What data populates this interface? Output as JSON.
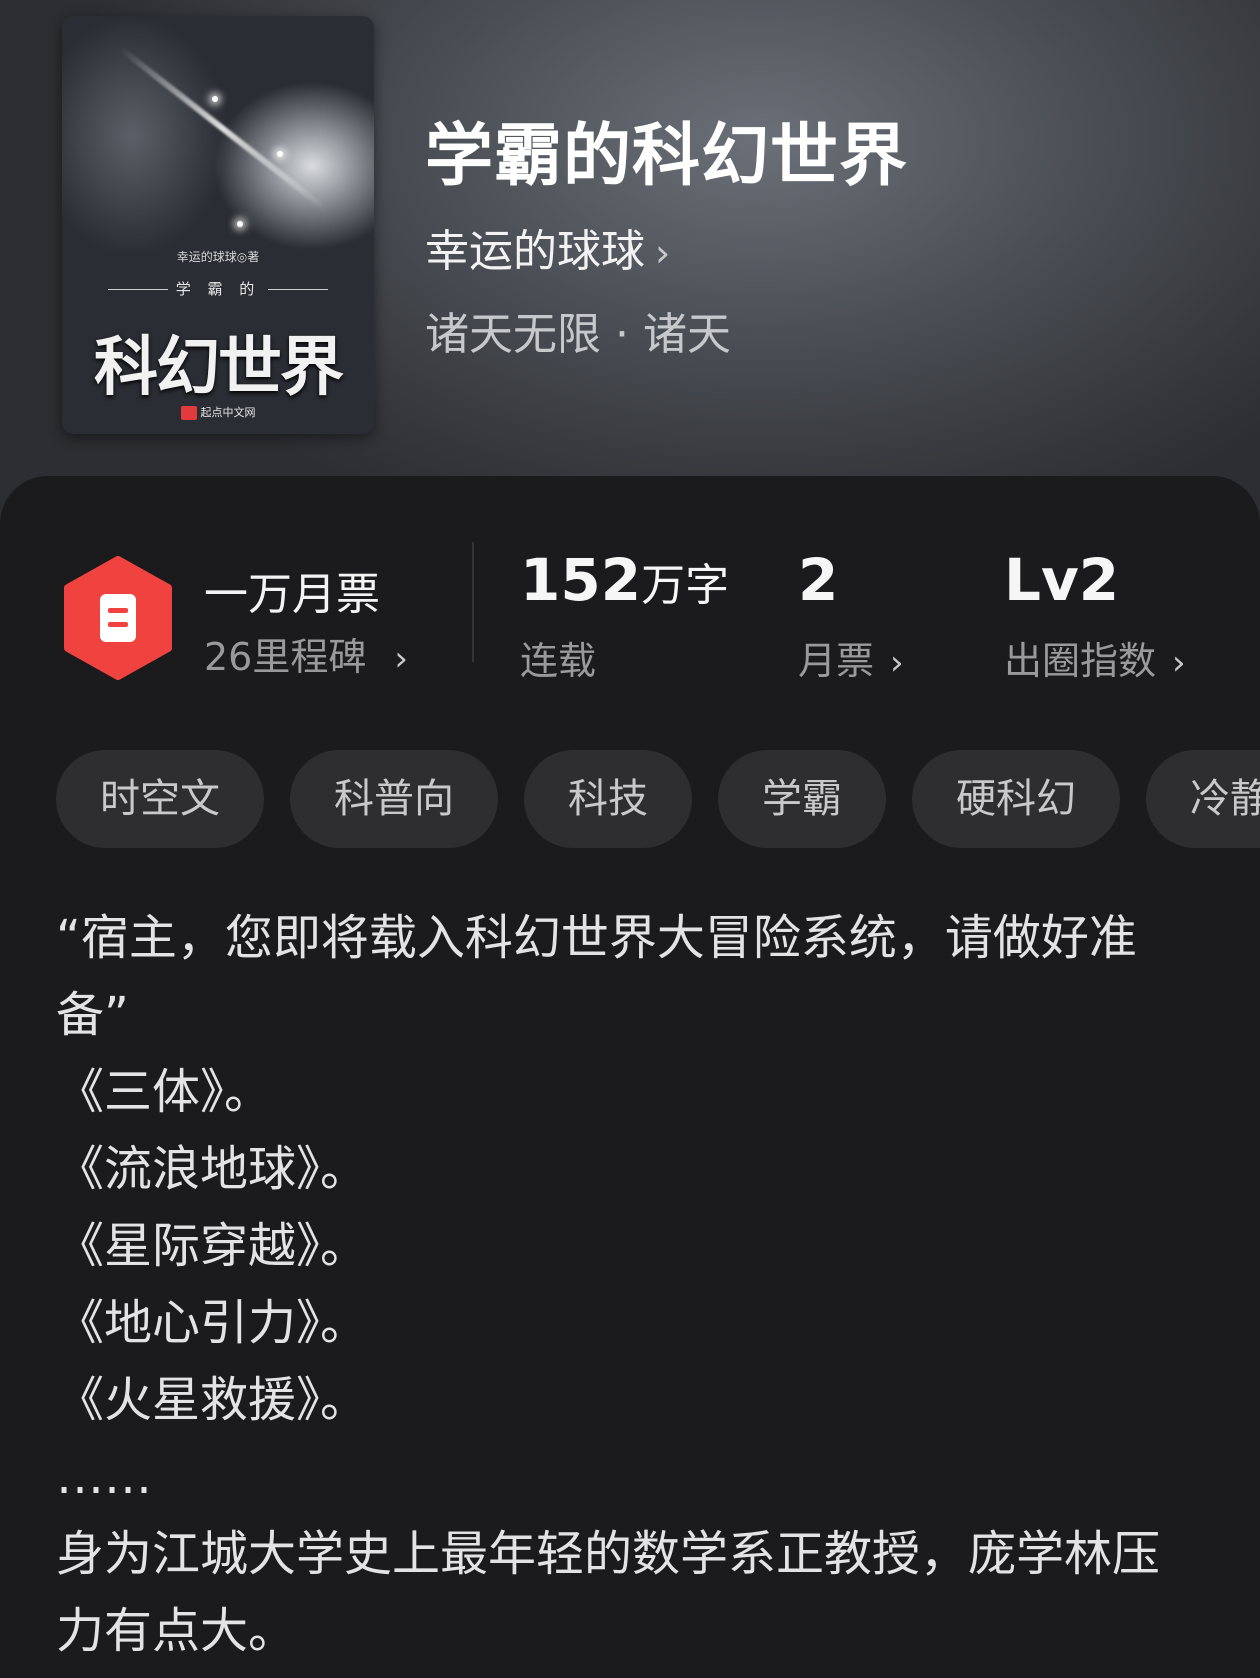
{
  "book": {
    "title": "学霸的科幻世界",
    "author": "幸运的球球",
    "category": "诸天无限",
    "subcategory": "诸天",
    "separator": "·"
  },
  "cover": {
    "author_line": "幸运的球球◎著",
    "sub_title": "学 霸 的",
    "title": "科幻世界",
    "publisher": "起点中文网"
  },
  "stats": {
    "honor_title": "一万月票",
    "honor_sub": "26里程碑",
    "words_value": "152",
    "words_unit": "万字",
    "words_label": "连载",
    "monthly_ticket_value": "2",
    "monthly_ticket_label": "月票",
    "popularity_value": "Lv2",
    "popularity_label": "出圈指数"
  },
  "tags": [
    "时空文",
    "科普向",
    "科技",
    "学霸",
    "硬科幻",
    "冷静"
  ],
  "synopsis": [
    "“宿主，您即将载入科幻世界大冒险系统，请做好准备”",
    "《三体》。",
    "《流浪地球》。",
    "《星际穿越》。",
    "《地心引力》。",
    "《火星救援》。",
    "……",
    "身为江城大学史上最年轻的数学系正教授，庞学林压力有点大。"
  ],
  "colors": {
    "badge_red": "#f0423f",
    "sheet_bg": "#1b1b1d",
    "tag_bg": "#2e2e31"
  },
  "icons": {
    "badge": "ticket-badge-icon",
    "chevron": "chevron-right-icon"
  }
}
